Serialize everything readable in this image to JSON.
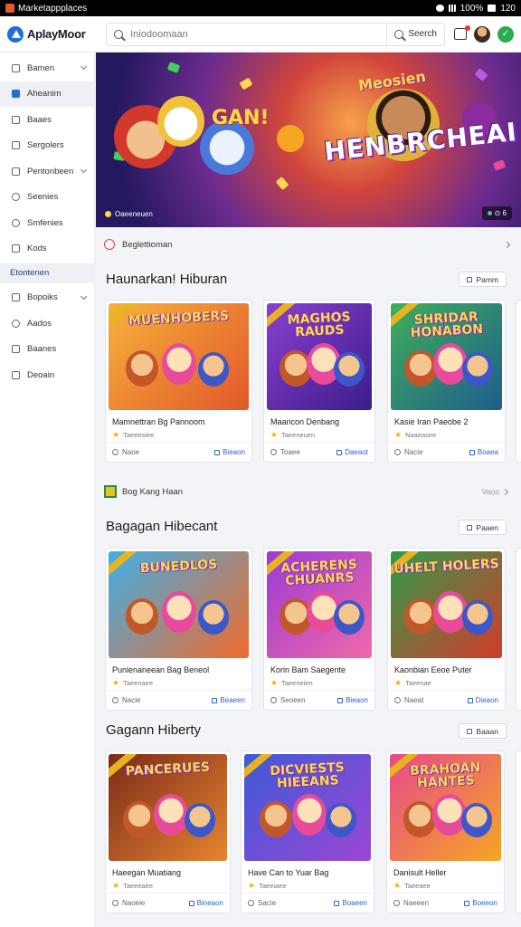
{
  "status_bar": {
    "title": "Marketappplaces",
    "battery": "100%",
    "time": "120"
  },
  "header": {
    "logo": "AplayMoor",
    "search_placeholder": "Iniodoomaan",
    "search_button": "Seerch"
  },
  "sidebar": {
    "items": [
      {
        "label": "Bamen",
        "has_chevron": true,
        "icon": "home-icon"
      },
      {
        "label": "Aheanim",
        "active": true,
        "icon": "grid-icon"
      },
      {
        "label": "Baaes",
        "icon": "box-icon"
      },
      {
        "label": "Sergolers",
        "icon": "tag-icon"
      },
      {
        "label": "Pentonbeen",
        "has_chevron": true,
        "icon": "list-icon"
      },
      {
        "label": "Seenies",
        "icon": "person-icon"
      },
      {
        "label": "Smfenies",
        "icon": "circle-icon"
      },
      {
        "label": "Kods",
        "icon": "book-icon"
      }
    ],
    "section": "Etontenen",
    "items2": [
      {
        "label": "Bopoiks",
        "has_chevron": true,
        "icon": "layers-icon"
      },
      {
        "label": "Aados",
        "icon": "gear-icon"
      },
      {
        "label": "Baanes",
        "icon": "calendar-icon"
      },
      {
        "label": "Deoain",
        "icon": "doc-icon"
      }
    ]
  },
  "hero": {
    "title": "HENBRCHEAI",
    "subtitle": "Meosien",
    "accent_text": "GAN!",
    "caption": "Oaeeneuen",
    "pill": "⊙ 6"
  },
  "breadcrumb": {
    "label": "Beglettioman"
  },
  "sections": [
    {
      "title": "Haunarkan! Hiburan",
      "button": "Pamm",
      "cards": [
        {
          "thumb_title": "MUENHOBERS",
          "name": "Mamnettran Bg Pannoom",
          "rating": "Taeeesiee",
          "time": "Naoe",
          "action": "Bieaon",
          "bg1": "#f6b23a",
          "bg2": "#e2572b"
        },
        {
          "thumb_title": "MAGHOS RAUDS",
          "name": "Maaricon Denbang",
          "rating": "Taeeneuen",
          "time": "Toaee",
          "action": "Daeaot",
          "bg1": "#8a3fd0",
          "bg2": "#3b1d8a"
        },
        {
          "thumb_title": "SHRIDAR HONABON",
          "name": "Kasie Iran Paeobe 2",
          "rating": "Naaeasee",
          "time": "Nacie",
          "action": "Boaea",
          "bg1": "#3fae5a",
          "bg2": "#1f5e8c"
        }
      ]
    },
    {
      "title": "Bagagan Hibecant",
      "button": "Paaen",
      "subrow": {
        "label": "Bog Kang Haan",
        "more": "Vaoo"
      },
      "cards": [
        {
          "thumb_title": "BUNEDLOS",
          "name": "Punlenaneean Bag Beneol",
          "rating": "Taeenaee",
          "time": "Nacie",
          "action": "Beaeen",
          "bg1": "#3fb0e8",
          "bg2": "#f06a2a"
        },
        {
          "thumb_title": "ACHERENS CHUANRS",
          "name": "Korin Bam Saegente",
          "rating": "Taeeneien",
          "time": "Seoeen",
          "action": "Bieaon",
          "bg1": "#9c3ad6",
          "bg2": "#f06aa8"
        },
        {
          "thumb_title": "UHELT HOLERS",
          "name": "Kaonbian Eeoe Puter",
          "rating": "Taeenae",
          "time": "Naeat",
          "action": "Dieaon",
          "bg1": "#2f9c4a",
          "bg2": "#d23b2b"
        }
      ]
    },
    {
      "title": "Gagann Hiberty",
      "button": "Baaan",
      "cards": [
        {
          "thumb_title": "PANCERUES",
          "name": "Haeegan Muatiang",
          "rating": "Taeeeaee",
          "time": "Naoeie",
          "action": "Bineaon",
          "bg1": "#7a2a1a",
          "bg2": "#e7852f"
        },
        {
          "thumb_title": "DICVIESTS HIEEANS",
          "name": "Have Can to Yuar Bag",
          "rating": "Taeeiaee",
          "time": "Sacie",
          "action": "Boaeen",
          "bg1": "#3f5ad6",
          "bg2": "#9b46d4"
        },
        {
          "thumb_title": "BRAHOAN HANTES",
          "name": "Danisult Heller",
          "rating": "Taeeaee",
          "time": "Naeeen",
          "action": "Boeeon",
          "bg1": "#e74a8b",
          "bg2": "#f5a623"
        }
      ]
    }
  ]
}
